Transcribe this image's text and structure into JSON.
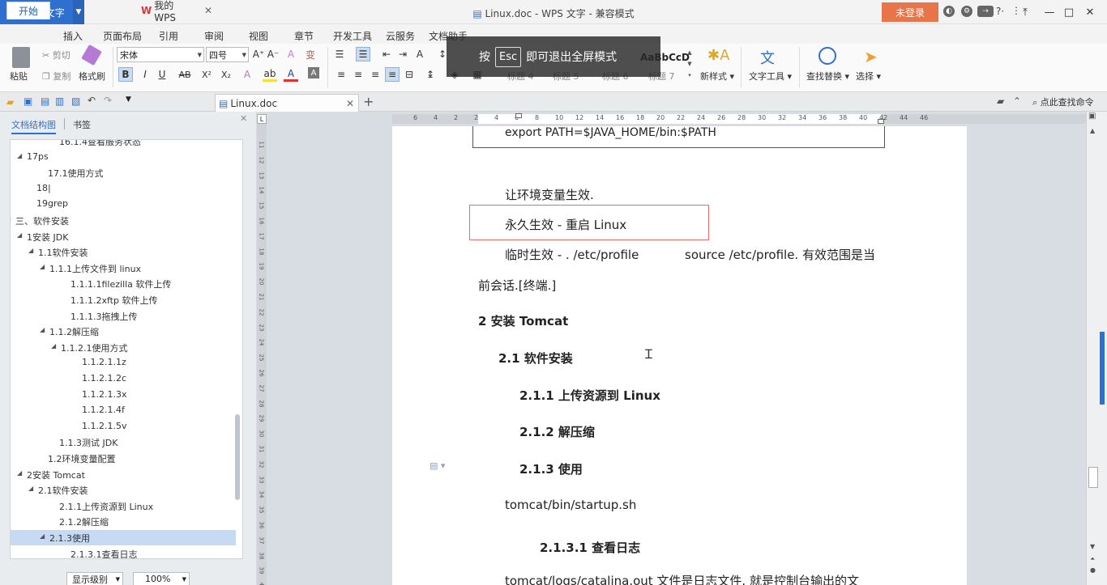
{
  "app": {
    "name": "WPS 文字",
    "window_title": "Linux.doc - WPS 文字 - 兼容模式",
    "login_label": "未登录"
  },
  "ribbon_tabs": [
    "开始",
    "插入",
    "页面布局",
    "引用",
    "审阅",
    "视图",
    "章节",
    "开发工具",
    "云服务",
    "文档助手"
  ],
  "ribbon": {
    "paste": "粘贴",
    "cut": "剪切",
    "copy": "复制",
    "format_painter": "格式刷",
    "font_name": "宋体",
    "font_size": "四号",
    "style_preview": "AaBbCcD",
    "style_labels": [
      "标题 4",
      "标题 5",
      "标题 6",
      "标题 7"
    ],
    "new_style": "新样式",
    "text_tools": "文字工具",
    "find_replace": "查找替换",
    "select": "选择"
  },
  "fullscreen_tip": {
    "prefix": "按",
    "key": "Esc",
    "suffix": "即可退出全屏模式"
  },
  "doc_tabs": {
    "home": "我的WPS",
    "file": "Linux.doc",
    "search": "点此查找命令"
  },
  "nav": {
    "tab_outline": "文档结构图",
    "tab_bookmark": "书签",
    "items": [
      {
        "label": "16.1.4查看服务状态",
        "level": 4
      },
      {
        "label": "17ps",
        "level": 2
      },
      {
        "label": "17.1使用方式",
        "level": 3
      },
      {
        "label": "18|",
        "level": 2
      },
      {
        "label": "19grep",
        "level": 2
      },
      {
        "label": "三、软件安装",
        "level": 1
      },
      {
        "label": "1安装 JDK",
        "level": 2
      },
      {
        "label": "1.1软件安装",
        "level": 3
      },
      {
        "label": "1.1.1上传文件到 linux",
        "level": 4
      },
      {
        "label": "1.1.1.1filezilla 软件上传",
        "level": 5
      },
      {
        "label": "1.1.1.2xftp 软件上传",
        "level": 5
      },
      {
        "label": "1.1.1.3拖拽上传",
        "level": 5
      },
      {
        "label": "1.1.2解压缩",
        "level": 4
      },
      {
        "label": "1.1.2.1使用方式",
        "level": 5
      },
      {
        "label": "1.1.2.1.1z",
        "level": 6
      },
      {
        "label": "1.1.2.1.2c",
        "level": 6
      },
      {
        "label": "1.1.2.1.3x",
        "level": 6
      },
      {
        "label": "1.1.2.1.4f",
        "level": 6
      },
      {
        "label": "1.1.2.1.5v",
        "level": 6
      },
      {
        "label": "1.1.3测试 JDK",
        "level": 4
      },
      {
        "label": "1.2环境变量配置",
        "level": 3
      },
      {
        "label": "2安装 Tomcat",
        "level": 2
      },
      {
        "label": "2.1软件安装",
        "level": 3
      },
      {
        "label": "2.1.1上传资源到 Linux",
        "level": 4
      },
      {
        "label": "2.1.2解压缩",
        "level": 4
      },
      {
        "label": "2.1.3使用",
        "level": 4
      },
      {
        "label": "2.1.3.1查看日志",
        "level": 5
      }
    ],
    "display_level": "显示级别",
    "zoom": "100%"
  },
  "ruler": {
    "h": [
      "6",
      "4",
      "2",
      "2",
      "4",
      "6",
      "8",
      "10",
      "12",
      "14",
      "16",
      "18",
      "20",
      "22",
      "24",
      "26",
      "28",
      "30",
      "32",
      "34",
      "36",
      "38",
      "40",
      "42",
      "44",
      "46"
    ],
    "v": [
      "11",
      "12",
      "13",
      "14",
      "15",
      "16",
      "17",
      "18",
      "19",
      "20",
      "21",
      "22",
      "23",
      "24",
      "25",
      "26",
      "27",
      "28",
      "29",
      "30",
      "31",
      "32",
      "33",
      "34",
      "35",
      "36",
      "37",
      "38",
      "39",
      "40",
      "41"
    ]
  },
  "document": {
    "code_line": "export PATH=$JAVA_HOME/bin:$PATH",
    "p1": "让环境变量生效.",
    "p2": "永久生效  -  重启 Linux",
    "p3a": "临时生效  - . /etc/profile",
    "p3b": "source /etc/profile.  有效范围是当",
    "p3c": "前会话.[终端.]",
    "h2": "2    安装 Tomcat",
    "h21": "2.1 软件安装",
    "h211": "2.1.1    上传资源到 Linux",
    "h212": "2.1.2    解压缩",
    "h213": "2.1.3    使用",
    "p4": "tomcat/bin/startup.sh",
    "h2131": "2.1.3.1      查看日志",
    "p5": "tomcat/logs/catalina.out   文件是日志文件.  就是控制台输出的文"
  }
}
